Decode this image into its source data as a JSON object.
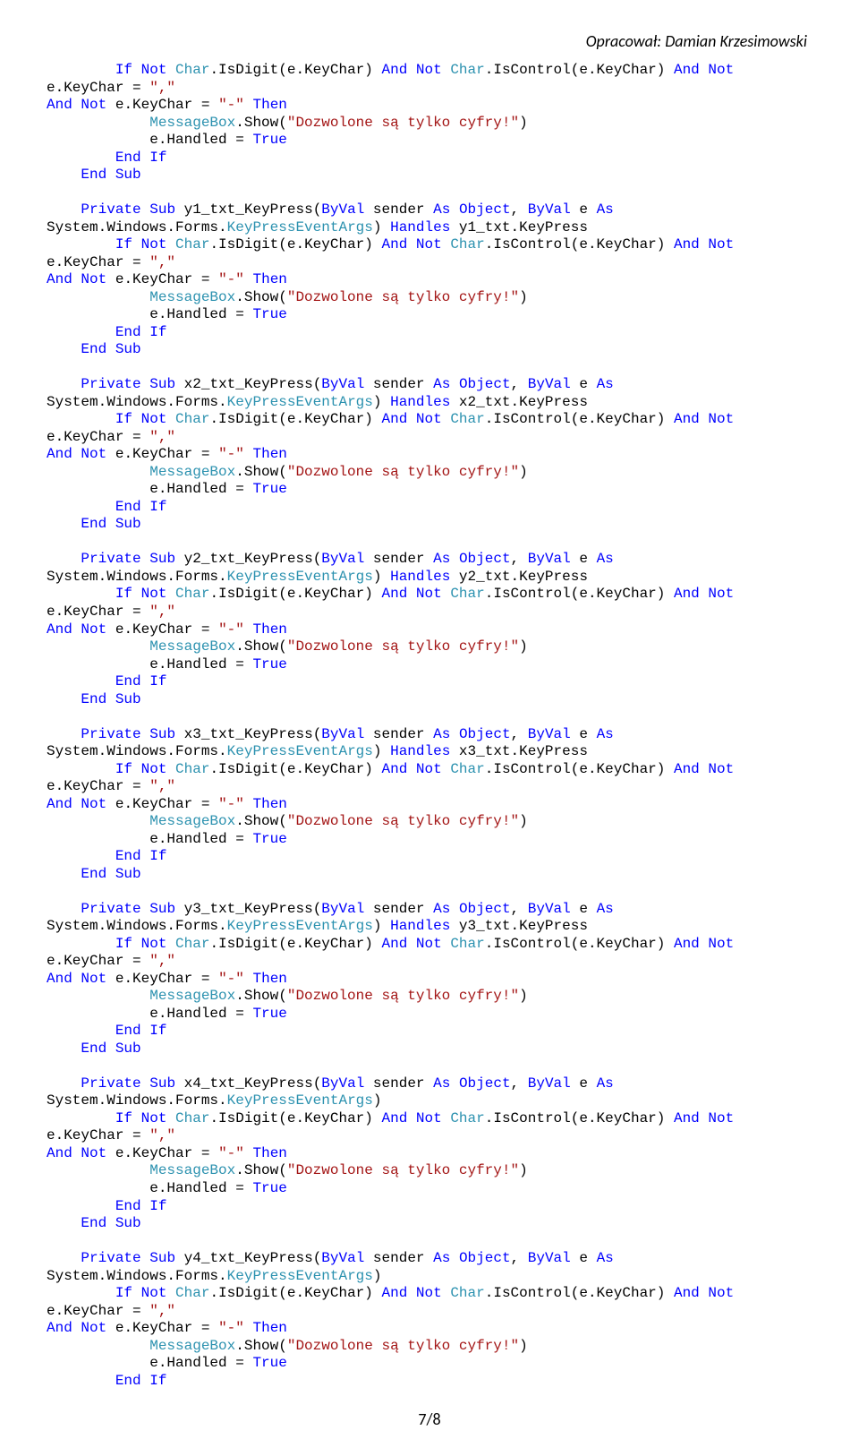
{
  "header": "Opracował: Damian Krzesimowski",
  "footer": "7/8",
  "subs": [
    {
      "name": "y1_txt_KeyPress",
      "handles": " Handles y1_txt.KeyPress"
    },
    {
      "name": "x2_txt_KeyPress",
      "handles": " Handles x2_txt.KeyPress"
    },
    {
      "name": "y2_txt_KeyPress",
      "handles": " Handles y2_txt.KeyPress"
    },
    {
      "name": "x3_txt_KeyPress",
      "handles": " Handles x3_txt.KeyPress"
    },
    {
      "name": "y3_txt_KeyPress",
      "handles": " Handles y3_txt.KeyPress"
    },
    {
      "name": "x4_txt_KeyPress",
      "handles": ""
    },
    {
      "name": "y4_txt_KeyPress",
      "handles": ""
    }
  ],
  "common": {
    "ifLine": "If Not Char.IsDigit(e.KeyChar) And Not Char.IsControl(e.KeyChar) And Not e.KeyChar = \",\" ",
    "andNot": "And Not e.KeyChar = \"-\" Then",
    "msg": "MessageBox.Show(\"Dozwolone są tylko cyfry!\")",
    "handled": "e.Handled = True",
    "endIf": "End If",
    "endSub": "End Sub",
    "privateSub": "Private Sub",
    "sig1": "(ByVal sender As Object, ByVal e As ",
    "sysWin": "System.Windows.Forms.",
    "argsType": "KeyPressEventArgs",
    "closeParen": ")"
  }
}
